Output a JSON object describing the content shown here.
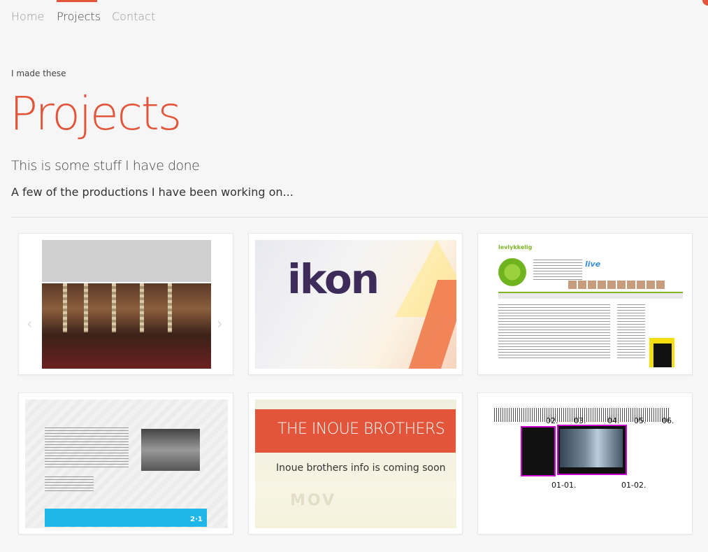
{
  "nav": {
    "items": [
      "Home",
      "Projects",
      "Contact"
    ],
    "active_index": 1
  },
  "header": {
    "kicker": "I made these",
    "title": "Projects",
    "subtitle": "This is some stuff I have done",
    "lead": "A few of the productions I have been working on..."
  },
  "projects": [
    {
      "name": "hotel-site",
      "prev_arrow": "‹",
      "next_arrow": "›"
    },
    {
      "name": "ikon",
      "word": "ikon"
    },
    {
      "name": "levlykkelig",
      "logo_text": "levlykkelig",
      "live": "live"
    },
    {
      "name": "blue-footer-site",
      "footer_logo": "2·1"
    },
    {
      "name": "inoue",
      "title": "THE INOUE BROTHERS",
      "info": "Inoue brothers info is coming soon",
      "faded": "MOV"
    },
    {
      "name": "numbered-gallery",
      "labels": [
        "02.",
        "03.",
        "04.",
        "05.",
        "06.",
        "01-01.",
        "01-02."
      ]
    }
  ],
  "colors": {
    "accent": "#e2553a",
    "background": "#f6f6f6"
  }
}
